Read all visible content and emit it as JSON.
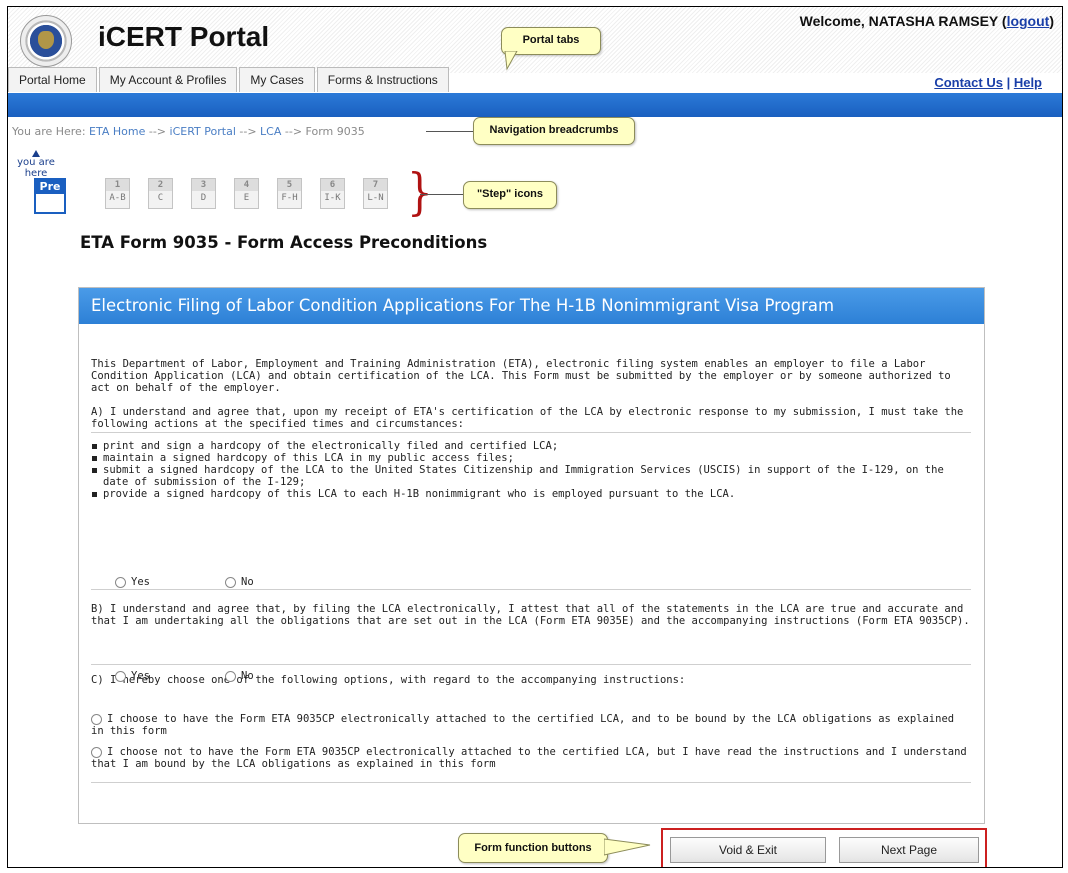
{
  "header": {
    "portal_title": "iCERT Portal",
    "welcome_prefix": "Welcome, NATASHA RAMSEY (",
    "logout": "logout",
    "welcome_suffix": ")",
    "contact_us": "Contact Us",
    "separator": " | ",
    "help": "Help",
    "seal_icon": "dol-seal-icon"
  },
  "tabs": [
    {
      "label": "Portal Home"
    },
    {
      "label": "My Account & Profiles"
    },
    {
      "label": "My Cases"
    },
    {
      "label": "Forms & Instructions"
    }
  ],
  "breadcrumb": {
    "prefix": "You are Here: ",
    "items": [
      "ETA Home",
      "iCERT Portal",
      "LCA",
      "Form 9035"
    ],
    "separator": " --> "
  },
  "steps": {
    "you_are_here": "you are here",
    "current": "Pre",
    "items": [
      {
        "num": "1",
        "range": "A-B"
      },
      {
        "num": "2",
        "range": "C"
      },
      {
        "num": "3",
        "range": "D"
      },
      {
        "num": "4",
        "range": "E"
      },
      {
        "num": "5",
        "range": "F-H"
      },
      {
        "num": "6",
        "range": "I-K"
      },
      {
        "num": "7",
        "range": "L-N"
      }
    ]
  },
  "callouts": {
    "portal_tabs": "Portal tabs",
    "navigation_breadcrumbs": "Navigation breadcrumbs",
    "step_icons": "\"Step\" icons",
    "form_function_buttons": "Form function buttons"
  },
  "page_title": "ETA Form 9035 - Form Access Preconditions",
  "panel": {
    "heading": "Electronic Filing of Labor Condition Applications For The H-1B Nonimmigrant Visa Program",
    "intro": "This Department of Labor, Employment and Training Administration (ETA), electronic filing system enables an employer to file a Labor Condition Application (LCA) and obtain certification of the LCA. This Form must be submitted by the employer or by someone authorized to act on behalf of the employer.",
    "question_a": "A) I understand and agree that, upon my receipt of ETA's certification of the LCA by electronic response to my submission, I must take the following actions at the specified times and circumstances:",
    "bullets": [
      "print and sign a hardcopy of the electronically filed and certified LCA;",
      "maintain a signed hardcopy of this LCA in my public access files;",
      "submit a signed hardcopy of the LCA to the United States Citizenship and Immigration Services (USCIS) in support of the I-129, on the date of submission of the I-129;",
      "provide a signed hardcopy of this LCA to each H-1B nonimmigrant who is employed pursuant to the LCA."
    ],
    "yes": "Yes",
    "no": "No",
    "question_b": "B) I understand and agree that, by filing the LCA electronically, I attest that all of the statements in the LCA are true and accurate and that I am undertaking all the obligations that are set out in the LCA (Form ETA 9035E) and the accompanying instructions (Form ETA 9035CP).",
    "question_c": "C) I hereby choose one of the following options, with regard to the accompanying instructions:",
    "option_c1": "I choose to have the Form ETA 9035CP electronically attached to the certified LCA, and to be bound by the LCA obligations as explained in this form",
    "option_c2": "I choose not to have the Form ETA 9035CP electronically attached to the certified LCA, but I have read the instructions and I understand that I am bound by the LCA obligations as explained in this form"
  },
  "buttons": {
    "void_exit": "Void & Exit",
    "next_page": "Next Page"
  }
}
